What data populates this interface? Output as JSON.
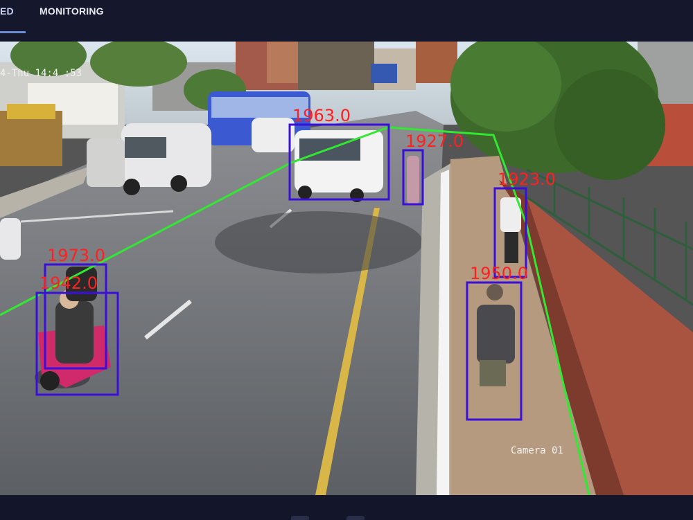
{
  "tabs": [
    {
      "label": "ED",
      "active": true
    },
    {
      "label": "MONITORING",
      "active": false
    }
  ],
  "feed": {
    "timestamp": "4-Thu 14:4 :53",
    "camera": "Camera 01",
    "detections": [
      {
        "label": "1963.0",
        "kind": "vehicle"
      },
      {
        "label": "1927.0",
        "kind": "person"
      },
      {
        "label": "1923.0",
        "kind": "person"
      },
      {
        "label": "1950.0",
        "kind": "person"
      },
      {
        "label": "1973.0",
        "kind": "rider"
      },
      {
        "label": "1942.0",
        "kind": "scooter"
      }
    ]
  },
  "colors": {
    "bbox": "#3a10d8",
    "label": "#ff2020",
    "zone_line": "#32e832",
    "bar": "#15172d"
  }
}
